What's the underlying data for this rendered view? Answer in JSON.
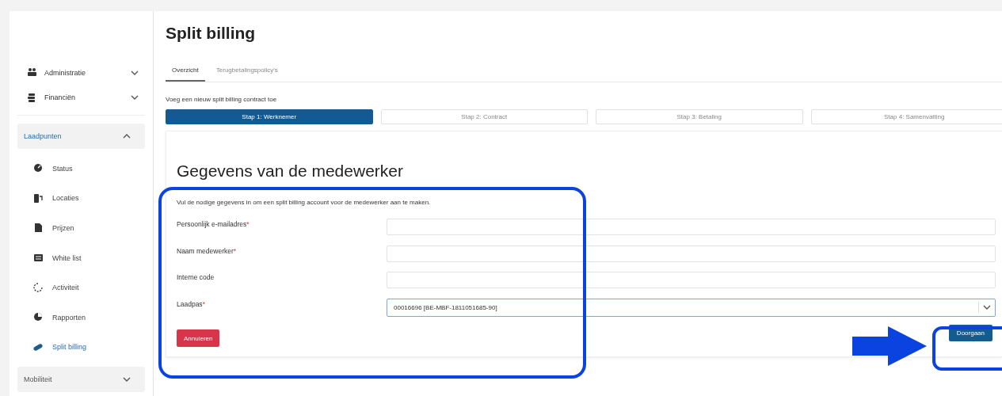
{
  "sidebar": {
    "items": [
      {
        "kind": "menu",
        "label": "Administratie",
        "expanded": false
      },
      {
        "kind": "menu",
        "label": "Financiën",
        "expanded": false
      },
      {
        "kind": "group",
        "label": "Laadpunten",
        "expanded": true,
        "children": [
          {
            "label": "Status",
            "selected": false
          },
          {
            "label": "Locaties",
            "selected": false
          },
          {
            "label": "Prijzen",
            "selected": false
          },
          {
            "label": "White list",
            "selected": false
          },
          {
            "label": "Activiteit",
            "selected": false
          },
          {
            "label": "Rapporten",
            "selected": false
          },
          {
            "label": "Split billing",
            "selected": true
          }
        ]
      },
      {
        "kind": "group",
        "label": "Mobiliteit",
        "expanded": false
      }
    ]
  },
  "page": {
    "title": "Split billing",
    "tabs": [
      {
        "label": "Overzicht",
        "selected": true
      },
      {
        "label": "Terugbetalingspolicy's",
        "selected": false
      }
    ],
    "subtitle": "Voeg een nieuw split billing contract toe",
    "steps": [
      {
        "label": "Stap 1: Werknemer",
        "selected": true
      },
      {
        "label": "Stap 2: Contract",
        "selected": false
      },
      {
        "label": "Stap 3: Betaling",
        "selected": false
      },
      {
        "label": "Stap 4: Samenvatting",
        "selected": false
      }
    ],
    "form": {
      "heading": "Gegevens van de medewerker",
      "intro": "Vul de nodige gegevens in om een split billing account voor de medewerker aan te maken.",
      "fields": [
        {
          "kind": "text",
          "label": "Persoonlijk e-mailadres",
          "required_mark": "*"
        },
        {
          "kind": "text",
          "label": "Naam medewerker",
          "required_mark": "*"
        },
        {
          "kind": "text",
          "label": "Interne code"
        },
        {
          "kind": "select",
          "label": "Laadpas",
          "required_mark": "*",
          "value": "00016696 [BE-MBF-1811051685-90]"
        }
      ],
      "cancel_button": "Annuleren",
      "continue_button": "Doorgaan"
    }
  }
}
